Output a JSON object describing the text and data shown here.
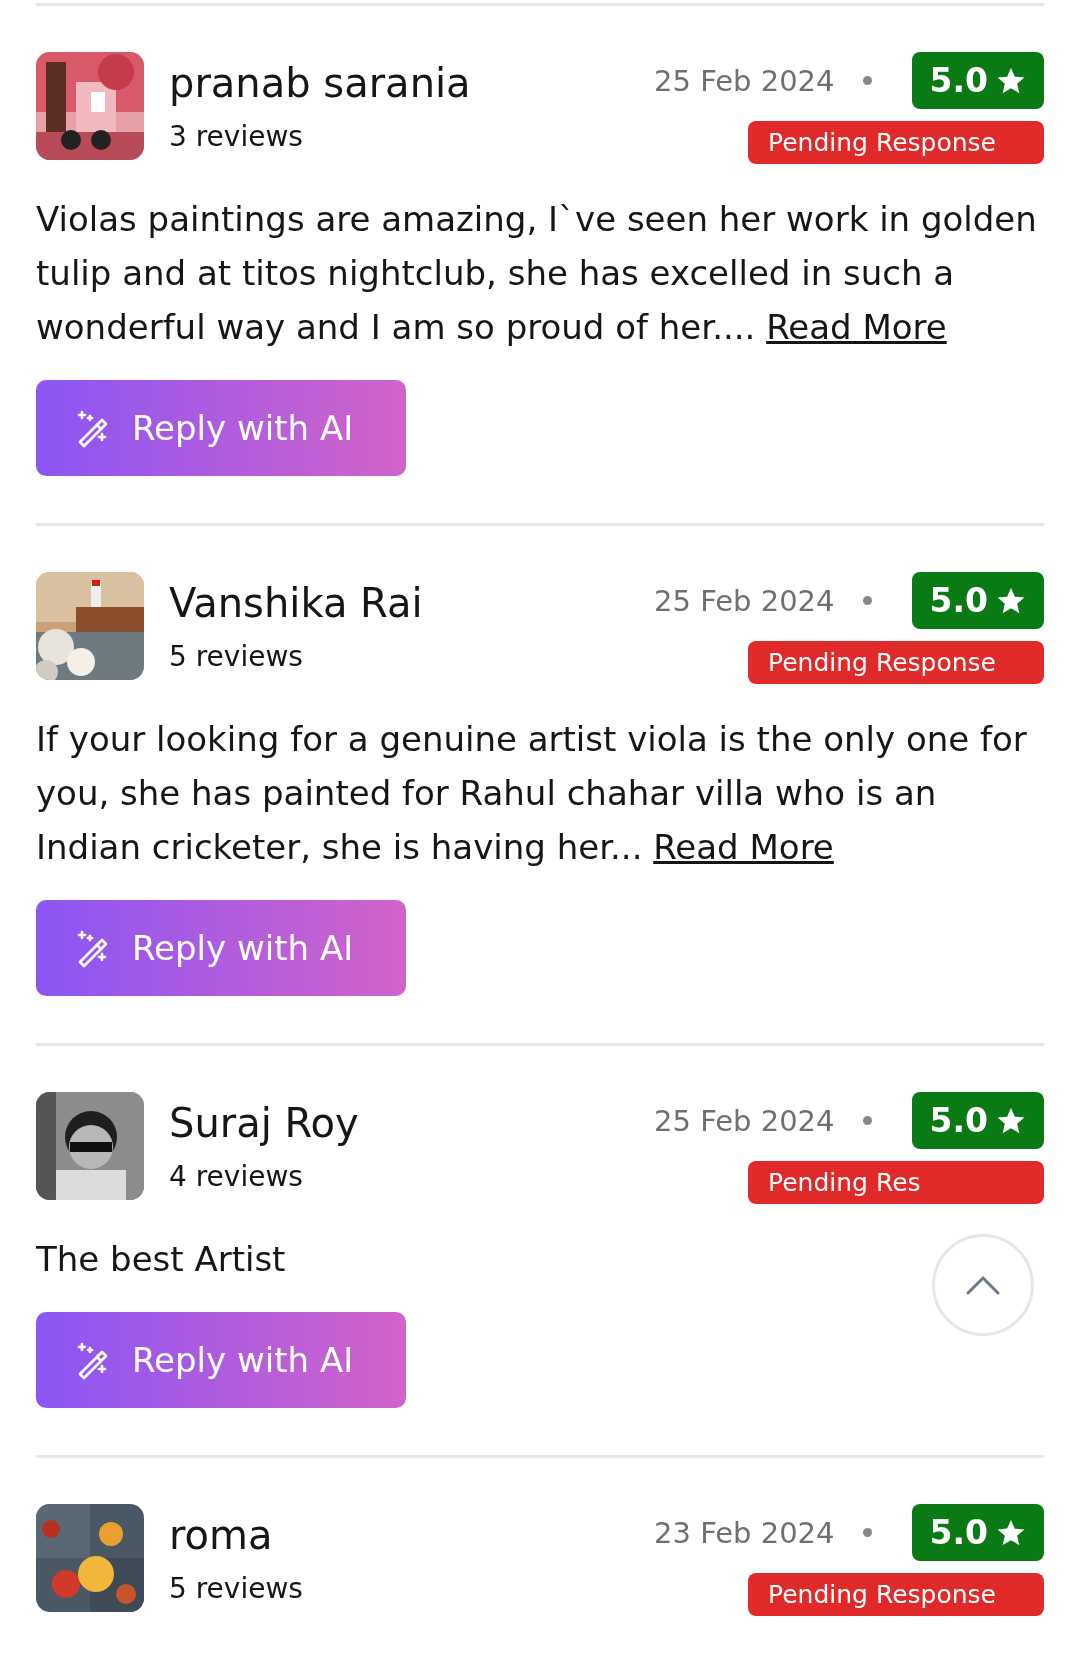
{
  "reviews": [
    {
      "name": "pranab sarania",
      "review_count": "3 reviews",
      "date": "25 Feb 2024",
      "rating": "5.0",
      "status": "Pending Response",
      "text": "Violas paintings are amazing, I`ve seen her work in golden tulip and at titos nightclub, she has excelled in such a wonderful way and I am so proud of her.... ",
      "link": "Read More",
      "button": "Reply with AI"
    },
    {
      "name": "Vanshika Rai",
      "review_count": "5 reviews",
      "date": "25 Feb 2024",
      "rating": "5.0",
      "status": "Pending Response",
      "text": "If your looking for a genuine artist viola is the only one for you, she has painted for Rahul chahar villa who is an Indian cricketer, she is having her... ",
      "link": "Read More",
      "button": "Reply with AI"
    },
    {
      "name": "Suraj Roy",
      "review_count": "4 reviews",
      "date": "25 Feb 2024",
      "rating": "5.0",
      "status": "Pending Res",
      "text": "The best Artist",
      "button": "Reply with AI"
    },
    {
      "name": "roma",
      "review_count": "5 reviews",
      "date": "23 Feb 2024",
      "rating": "5.0",
      "status": "Pending Response"
    }
  ]
}
